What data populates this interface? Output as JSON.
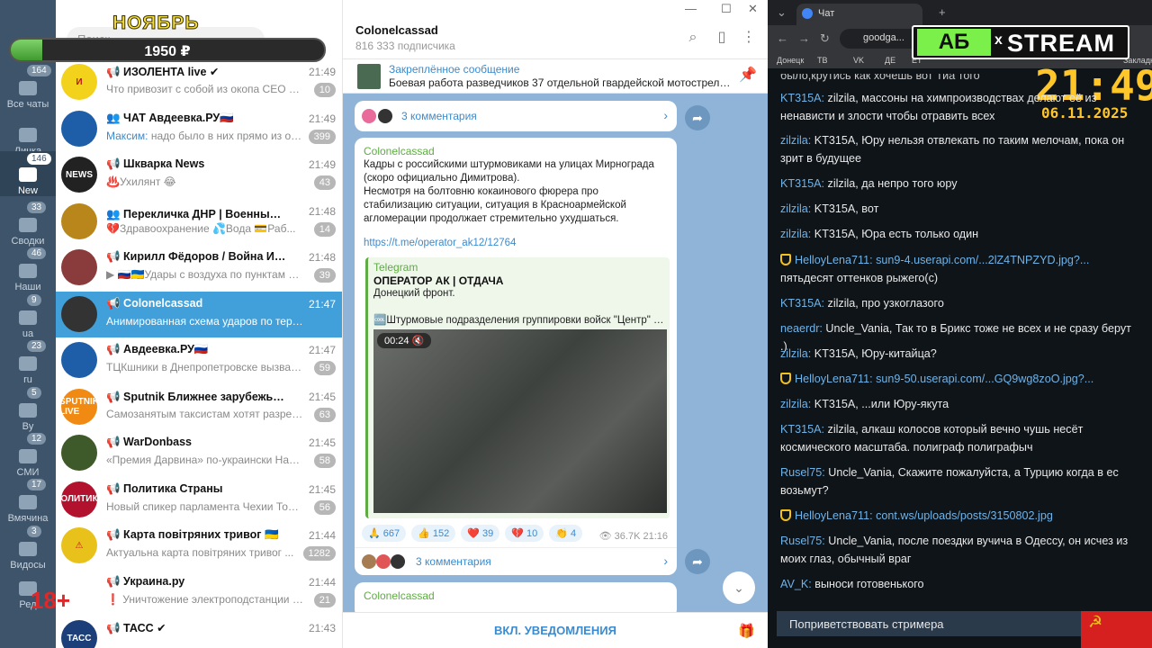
{
  "telegram": {
    "search_placeholder": "Поиск",
    "promo": {
      "title": "НОЯБРЬ",
      "amount": "1950 ₽",
      "progress_fraction": 0.1
    },
    "age_label": "18+",
    "folders": [
      {
        "label": "Все чаты",
        "badge": "164"
      },
      {
        "label": "Личка",
        "badge": ""
      },
      {
        "label": "New",
        "badge": "146"
      },
      {
        "label": "Сводки",
        "badge": "33"
      },
      {
        "label": "Наши",
        "badge": "46"
      },
      {
        "label": "ua",
        "badge": "9"
      },
      {
        "label": "ru",
        "badge": "23"
      },
      {
        "label": "By",
        "badge": "5"
      },
      {
        "label": "СМИ",
        "badge": "12"
      },
      {
        "label": "Вмячина",
        "badge": "17"
      },
      {
        "label": "Видосы",
        "badge": "3"
      },
      {
        "label": "Ред",
        "badge": ""
      }
    ],
    "chats": [
      {
        "name": "📢 ИЗОЛЕНТА live ✔",
        "time": "21:49",
        "preview": "Что привозит с собой из окопа СЕО ма...",
        "sender": "",
        "badge": "10",
        "avatar_text": "И",
        "color": "#f2d21a"
      },
      {
        "name": "👥 ЧАТ Авдеевка.РУ🇷🇺",
        "time": "21:49",
        "preview": "надо было в них прямо из окна ...",
        "sender": "Максим:",
        "badge": "399",
        "avatar_text": "",
        "color": "#1e5ea8"
      },
      {
        "name": "📢 Шкварка News",
        "time": "21:49",
        "preview": "♨️Ухилянт 😂",
        "sender": "",
        "badge": "43",
        "avatar_text": "NEWS",
        "color": "#222222"
      },
      {
        "name": "👥 Перекличка ДНР | Военный ⓩ Доне...",
        "time": "21:48",
        "preview": "💔Здравоохранение 💦Вода 💳Раб...",
        "sender": "",
        "badge": "14",
        "avatar_text": "",
        "color": "#b8861a"
      },
      {
        "name": "📢 Кирилл Фёдоров / Война История О...",
        "time": "21:48",
        "preview": "▶ 🇷🇺🇺🇦Удары с воздуха по пунктам дисл...",
        "sender": "",
        "badge": "39",
        "avatar_text": "",
        "color": "#8a3b3b"
      },
      {
        "name": "📢 Colonelcassad",
        "time": "21:47",
        "preview": "Анимированная схема ударов по территор...",
        "sender": "",
        "badge": "",
        "avatar_text": "",
        "color": "#333333"
      },
      {
        "name": "📢 Авдеевка.РУ🇷🇺",
        "time": "21:47",
        "preview": "ТЦКшники в Днепропетровске вызвал...",
        "sender": "",
        "badge": "59",
        "avatar_text": "",
        "color": "#1e5ea8"
      },
      {
        "name": "📢 Sputnik Ближнее зарубежье ✔",
        "time": "21:45",
        "preview": "Самозанятым таксистам хотят разреш...",
        "sender": "",
        "badge": "63",
        "avatar_text": "SPUTNIK LIVE",
        "color": "#f08a12"
      },
      {
        "name": "📢 WarDonbass",
        "time": "21:45",
        "preview": "«Премия Дарвина» по-украински  Наш ...",
        "sender": "",
        "badge": "58",
        "avatar_text": "",
        "color": "#3e5a2a"
      },
      {
        "name": "📢 Политика Страны",
        "time": "21:45",
        "preview": "Новый спикер парламента Чехии Томи...",
        "sender": "",
        "badge": "56",
        "avatar_text": "ПОЛИТИКА",
        "color": "#b3122e"
      },
      {
        "name": "📢 Карта повітряних тривог 🇺🇦",
        "time": "21:44",
        "preview": "Актуальна карта повітряних тривог ...",
        "sender": "",
        "badge": "1282",
        "avatar_text": "⚠",
        "color": "#e8c21a"
      },
      {
        "name": "📢 Украина.ру",
        "time": "21:44",
        "preview": "❗ Уничтожение электроподстанции в Па...",
        "sender": "",
        "badge": "21",
        "avatar_text": "",
        "color": "#ffffff"
      },
      {
        "name": "📢 ТАСС ✔",
        "time": "21:43",
        "preview": "",
        "sender": "",
        "badge": "",
        "avatar_text": "ТАСС",
        "color": "#1c3f7a"
      }
    ],
    "channel": {
      "title": "Colonelcassad",
      "subscribers": "816 333 подписчика",
      "pinned_title": "Закреплённое сообщение",
      "pinned_text": "Боевая работа разведчиков 37 отдельной гвардейской мотострелков..."
    },
    "messages": {
      "top_comments": "3 комментария",
      "post": {
        "sender": "Colonelcassad",
        "text": "Кадры с российскими штурмовиками на улицах Мирнограда (скоро официально Димитрова).\nНесмотря на болтовню кокаинового фюрера про стабилизацию ситуации, ситуация в Красноармейской агломерации продолжает стремительно ухудшаться.",
        "link": "https://t.me/operator_ak12/12764",
        "preview_site": "Telegram",
        "preview_title": "ОПЕРАТОР АК | ОТДАЧА",
        "preview_desc": "Донецкий фронт.",
        "preview_desc2": "🆒Штурмовые подразделения группировки войск \"Центр\" п...",
        "video_time": "00:24",
        "reactions": [
          "🙏 667",
          "👍 152",
          "❤️ 39",
          "💔 10",
          "👏 4"
        ],
        "views": "36.7K",
        "time": "21:16",
        "comments": "3 комментария"
      },
      "next_sender": "Colonelcassad"
    },
    "notify_button": "ВКЛ. УВЕДОМЛЕНИЯ"
  },
  "browser": {
    "tab_title": "Чат",
    "url": "goodga...",
    "bookmarks": [
      "Донецк",
      "ТВ",
      "VK",
      "ДЕ",
      "ЕТ",
      "Закладки"
    ],
    "logo": {
      "left": "АБ",
      "x": "x",
      "right": "STREAM"
    },
    "clock": "21:49",
    "date": "06.11.2025",
    "chat": [
      {
        "user": "",
        "text": "было,крутись как хочешь вот Тиа того",
        "shield": false
      },
      {
        "user": "KT315A:",
        "text": "zilzila, массоны на химпроизводствах делают её из ненависти и злости чтобы отравить всех",
        "shield": false
      },
      {
        "user": "zilzila:",
        "text": "KT315A, Юру нельзя отвлекать по таким мелочам, пока он зрит в будущее",
        "shield": false
      },
      {
        "user": "KT315A:",
        "text": "zilzila, да непро того юру",
        "shield": false
      },
      {
        "user": "zilzila:",
        "text": "KT315A, вот",
        "shield": false
      },
      {
        "user": "zilzila:",
        "text": "KT315A, Юра есть только один",
        "shield": false
      },
      {
        "user": "HelloyLena711:",
        "link": "sun9-4.userapi.com/...2lZ4TNPZYD.jpg?...",
        "text": "пятьдесят оттенков рыжего(с)",
        "shield": true
      },
      {
        "user": "KT315A:",
        "text": "zilzila, про узкоглазого",
        "shield": false
      },
      {
        "user": "neaerdr:",
        "text": "Uncle_Vania, Так то в Брикс тоже не всех и не сразу берут .)",
        "shield": false
      },
      {
        "user": "zilzila:",
        "text": "KT315A, Юру-китайца?",
        "shield": false
      },
      {
        "user": "HelloyLena711:",
        "link": "sun9-50.userapi.com/...GQ9wg8zoO.jpg?...",
        "text": "",
        "shield": true
      },
      {
        "user": "zilzila:",
        "text": "KT315A, ...или Юру-якута",
        "shield": false
      },
      {
        "user": "KT315A:",
        "text": "zilzila, алкаш колосов который вечно чушь несёт космического масштаба. полиграф полиграфыч",
        "shield": false
      },
      {
        "user": "Rusel75:",
        "text": "Uncle_Vania, Скажите пожалуйста, а Турцию когда в ес возьмут?",
        "shield": false
      },
      {
        "user": "HelloyLena711:",
        "link": "cont.ws/uploads/posts/3150802.jpg",
        "text": "",
        "shield": true
      },
      {
        "user": "Rusel75:",
        "text": "Uncle_Vania, после поездки вучича в Одессу, он исчез из моих глаз, обычный враг",
        "shield": false
      },
      {
        "user": "AV_K:",
        "text": "выноси готовенького",
        "shield": false
      }
    ],
    "greet_button": "Поприветствовать стримера",
    "flag_symbol": "☭"
  }
}
